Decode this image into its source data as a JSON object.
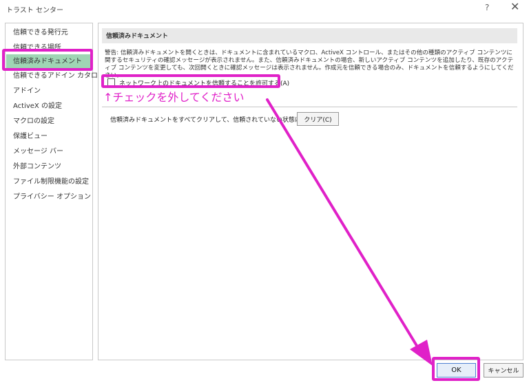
{
  "window": {
    "title": "トラスト センター",
    "help_label": "?",
    "close_label": "✕"
  },
  "sidebar": {
    "items": [
      {
        "label": "信頼できる発行元",
        "selected": false
      },
      {
        "label": "信頼できる場所",
        "selected": false
      },
      {
        "label": "信頼済みドキュメント",
        "selected": true
      },
      {
        "label": "信頼できるアドイン カタログ",
        "selected": false
      },
      {
        "label": "アドイン",
        "selected": false
      },
      {
        "label": "ActiveX の設定",
        "selected": false
      },
      {
        "label": "マクロの設定",
        "selected": false
      },
      {
        "label": "保護ビュー",
        "selected": false
      },
      {
        "label": "メッセージ バー",
        "selected": false
      },
      {
        "label": "外部コンテンツ",
        "selected": false
      },
      {
        "label": "ファイル制限機能の設定",
        "selected": false
      },
      {
        "label": "プライバシー オプション",
        "selected": false
      }
    ]
  },
  "main": {
    "section_title": "信頼済みドキュメント",
    "warning_text": "警告: 信頼済みドキュメントを開くときは、ドキュメントに含まれているマクロ、ActiveX コントロール、またはその他の種類のアクティブ コンテンツに関するセキュリティの確認メッセージが表示されません。また、信頼済みドキュメントの場合、新しいアクティブ コンテンツを追加したり、既存のアクティブ コンテンツを変更しても、次回開くときに確認メッセージは表示されません。作成元を信頼できる場合のみ、ドキュメントを信頼するようにしてください。",
    "network_checkbox": {
      "label": "ネットワーク上のドキュメントを信頼することを許可する(A)",
      "checked": false
    },
    "clear_text": "信頼済みドキュメントをすべてクリアして、信頼されていない状態にする",
    "clear_button": "クリア(C)"
  },
  "annotation": {
    "text": "↑チェックを外してください",
    "color": "#e021c8"
  },
  "footer": {
    "ok_button": "OK",
    "cancel_button": "キャンセル"
  },
  "colors": {
    "selected_item": "#9fd5b4",
    "highlight": "#e021c8"
  }
}
